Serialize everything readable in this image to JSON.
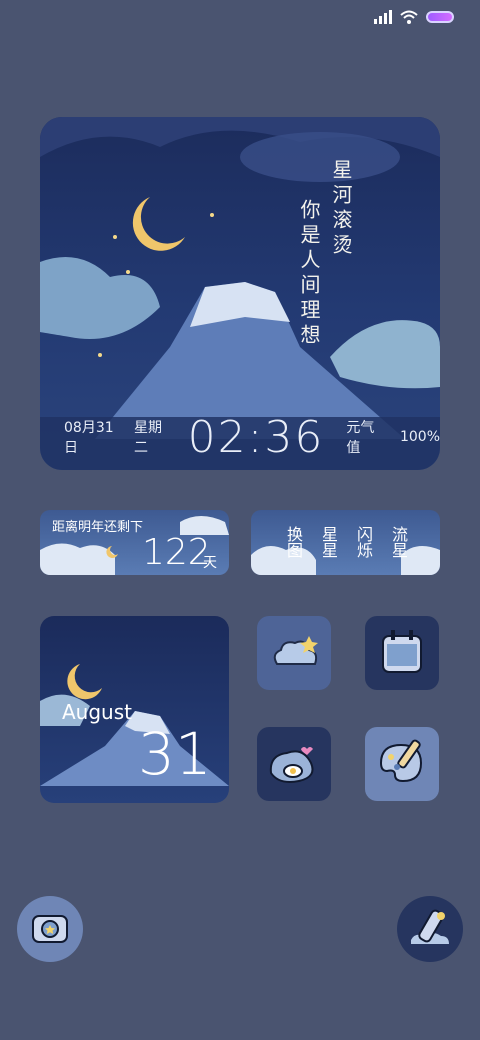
{
  "status_bar": {
    "signal_icon": "signal-icon",
    "wifi_icon": "wifi-icon",
    "battery_icon": "battery-icon"
  },
  "big_widget": {
    "poem_line_1": "星河滚烫",
    "poem_line_2": "你是人间理想",
    "date": "08月31日",
    "weekday": "星期二",
    "time": "02:36",
    "air_label": "元气值",
    "air_value": "100%"
  },
  "countdown_widget": {
    "label": "距离明年还剩下",
    "number": "122",
    "unit": "天"
  },
  "wallpaper_widget": {
    "col1": "换图",
    "col2": "星星",
    "col3": "闪烁",
    "col4": "流星"
  },
  "date_widget": {
    "month": "August",
    "day": "31"
  },
  "apps": {
    "cloud_star": "cloud-star-icon",
    "calendar": "calendar-icon",
    "egg_stone": "egg-stone-icon",
    "palette": "palette-icon"
  },
  "dock": {
    "camera": "camera-icon",
    "telescope": "telescope-icon"
  }
}
